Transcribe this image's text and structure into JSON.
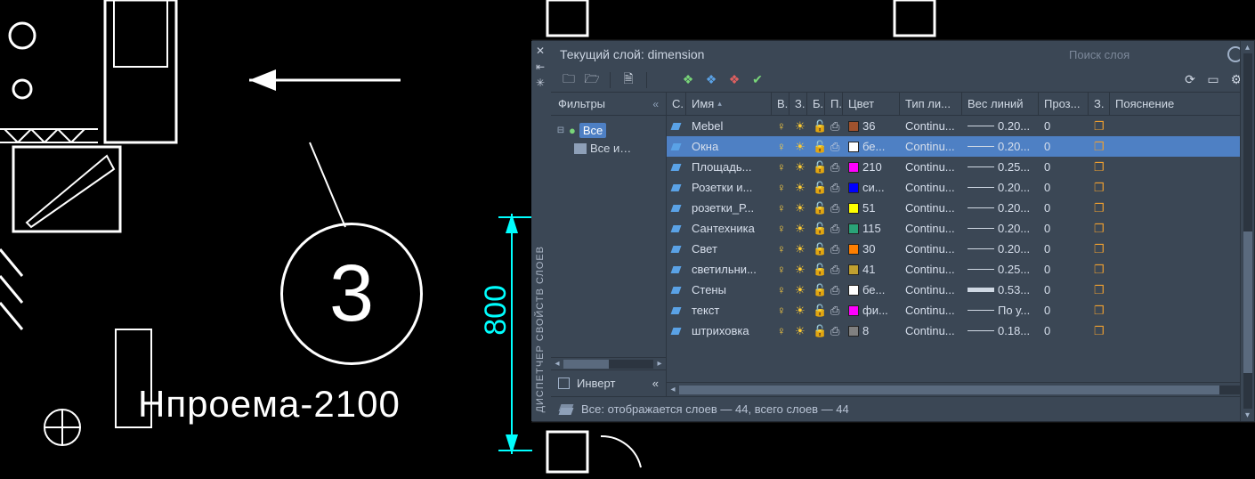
{
  "cad": {
    "circle_number": "3",
    "dimension_vertical": "800",
    "annotation_text": "Нпроема-2100"
  },
  "panel": {
    "vertical_title": "ДИСПЕТЧЕР СВОЙСТВ СЛОЕВ",
    "title_prefix": "Текущий слой:",
    "current_layer": "dimension",
    "search_placeholder": "Поиск слоя",
    "filters_header": "Фильтры",
    "tree": {
      "root": "Все",
      "child": "Все и…"
    },
    "invert_label": "Инверт",
    "status": "Все: отображается слоев — 44, всего слоев — 44",
    "columns": {
      "status": "С.",
      "name": "Имя",
      "visible": "В.",
      "freeze": "З.",
      "lock": "Б.",
      "plot": "П.",
      "color": "Цвет",
      "linetype": "Тип ли...",
      "lineweight": "Вес линий",
      "transparency": "Проз...",
      "z2": "З.",
      "description": "Пояснение"
    },
    "layers": [
      {
        "name": "Mebel",
        "color_hex": "#a0522d",
        "color_name": "36",
        "linetype": "Continu...",
        "lineweight": "0.20...",
        "lw_class": "t",
        "transparency": "0",
        "selected": false
      },
      {
        "name": "Окна",
        "color_hex": "#ffffff",
        "color_name": "бе...",
        "linetype": "Continu...",
        "lineweight": "0.20...",
        "lw_class": "t",
        "transparency": "0",
        "selected": true
      },
      {
        "name": "Площадь...",
        "color_hex": "#ff00ff",
        "color_name": "210",
        "linetype": "Continu...",
        "lineweight": "0.25...",
        "lw_class": "t",
        "transparency": "0",
        "selected": false
      },
      {
        "name": "Розетки  и...",
        "color_hex": "#0000ff",
        "color_name": "си...",
        "linetype": "Continu...",
        "lineweight": "0.20...",
        "lw_class": "t",
        "transparency": "0",
        "selected": false
      },
      {
        "name": "розетки_Р...",
        "color_hex": "#ffff00",
        "color_name": "51",
        "linetype": "Continu...",
        "lineweight": "0.20...",
        "lw_class": "t",
        "transparency": "0",
        "selected": false
      },
      {
        "name": "Сантехника",
        "color_hex": "#2aa378",
        "color_name": "115",
        "linetype": "Continu...",
        "lineweight": "0.20...",
        "lw_class": "t",
        "transparency": "0",
        "selected": false
      },
      {
        "name": "Свет",
        "color_hex": "#ff7f00",
        "color_name": "30",
        "linetype": "Continu...",
        "lineweight": "0.20...",
        "lw_class": "t",
        "transparency": "0",
        "selected": false
      },
      {
        "name": "светильни...",
        "color_hex": "#c0a030",
        "color_name": "41",
        "linetype": "Continu...",
        "lineweight": "0.25...",
        "lw_class": "t",
        "transparency": "0",
        "selected": false
      },
      {
        "name": "Стены",
        "color_hex": "#ffffff",
        "color_name": "бе...",
        "linetype": "Continu...",
        "lineweight": "0.53...",
        "lw_class": "h",
        "transparency": "0",
        "selected": false
      },
      {
        "name": "текст",
        "color_hex": "#ff00ff",
        "color_name": "фи...",
        "linetype": "Continu...",
        "lineweight": "По у...",
        "lw_class": "t",
        "transparency": "0",
        "selected": false
      },
      {
        "name": "штриховка",
        "color_hex": "#808080",
        "color_name": "8",
        "linetype": "Continu...",
        "lineweight": "0.18...",
        "lw_class": "t",
        "transparency": "0",
        "selected": false
      }
    ]
  }
}
